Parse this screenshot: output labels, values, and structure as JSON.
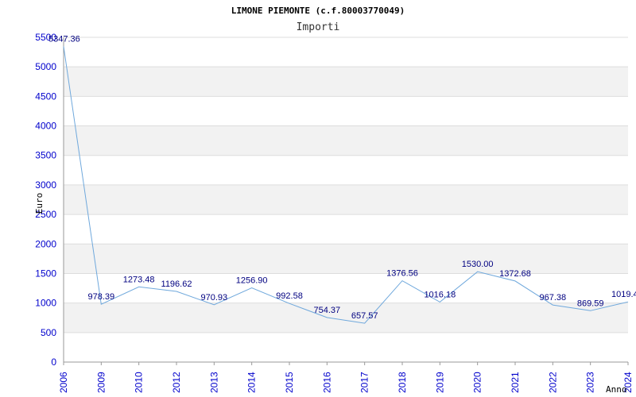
{
  "chart_data": {
    "type": "line",
    "title": "LIMONE PIEMONTE (c.f.80003770049)",
    "subtitle": "Importi",
    "ylabel": "Euro",
    "xlabel": "Anno",
    "categories": [
      "2006",
      "2009",
      "2010",
      "2012",
      "2013",
      "2014",
      "2015",
      "2016",
      "2017",
      "2018",
      "2019",
      "2020",
      "2021",
      "2022",
      "2023",
      "2024"
    ],
    "values": [
      5347.36,
      978.39,
      1273.48,
      1196.62,
      970.93,
      1256.9,
      992.58,
      754.37,
      657.57,
      1376.56,
      1016.18,
      1530.0,
      1372.68,
      967.38,
      869.59,
      1019.4
    ],
    "value_labels": [
      "5347.36",
      "978.39",
      "1273.48",
      "1196.62",
      "970.93",
      "1256.90",
      "992.58",
      "754.37",
      "657.57",
      "1376.56",
      "1016.18",
      "1530.00",
      "1372.68",
      "967.38",
      "869.59",
      "1019.4"
    ],
    "yticks": [
      "0",
      "500",
      "1000",
      "1500",
      "2000",
      "2500",
      "3000",
      "3500",
      "4000",
      "4500",
      "5000",
      "5500"
    ],
    "ylim": [
      0,
      5500
    ],
    "grid": "horizontal bands",
    "colors": {
      "line": "#6fa8dc",
      "band": "#f2f2f2",
      "grid": "#dddddd",
      "tick_text": "#0000cc",
      "label_text": "#000080"
    }
  }
}
